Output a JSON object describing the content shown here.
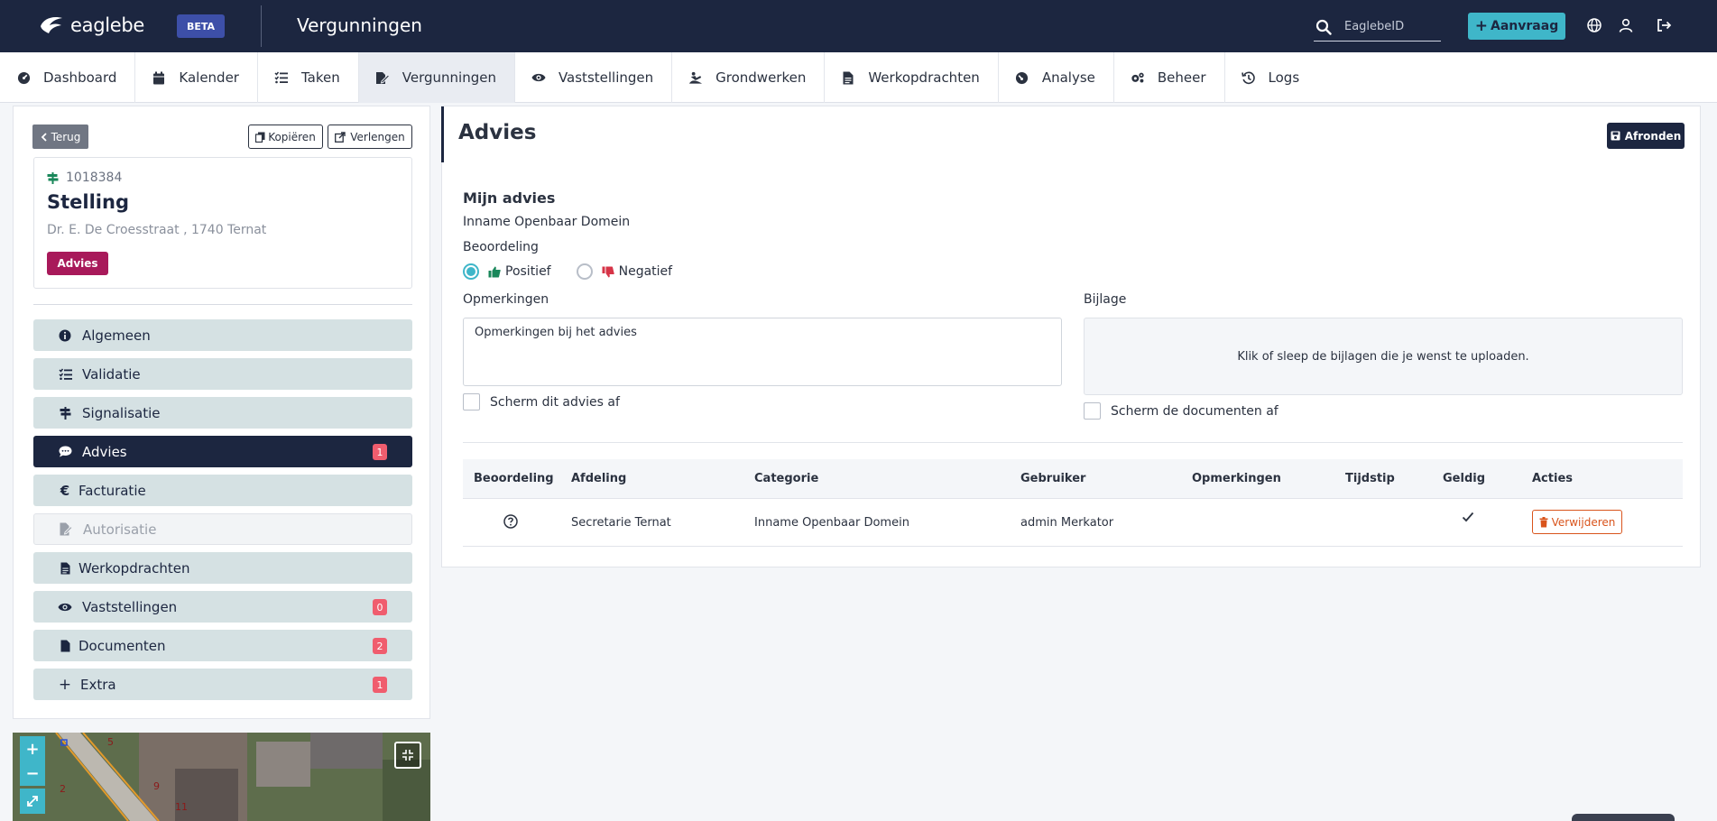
{
  "brand": {
    "logo_text": "eaglebe",
    "beta": "BETA",
    "app_title": "Vergunningen"
  },
  "header": {
    "search_placeholder": "EaglebeID",
    "aanvraag_label": "Aanvraag"
  },
  "nav": [
    {
      "label": "Dashboard",
      "icon": "dashboard-icon"
    },
    {
      "label": "Kalender",
      "icon": "calendar-icon"
    },
    {
      "label": "Taken",
      "icon": "tasks-icon"
    },
    {
      "label": "Vergunningen",
      "icon": "permit-icon",
      "active": true
    },
    {
      "label": "Vaststellingen",
      "icon": "eye-icon"
    },
    {
      "label": "Grondwerken",
      "icon": "digging-icon"
    },
    {
      "label": "Werkopdrachten",
      "icon": "document-icon"
    },
    {
      "label": "Analyse",
      "icon": "gauge-icon"
    },
    {
      "label": "Beheer",
      "icon": "gears-icon"
    },
    {
      "label": "Logs",
      "icon": "history-icon"
    }
  ],
  "left": {
    "back_label": "Terug",
    "copy_label": "Kopiëren",
    "extend_label": "Verlengen",
    "card": {
      "id": "1018384",
      "title": "Stelling",
      "address": "Dr. E. De Croesstraat , 1740 Ternat",
      "status": "Advies"
    },
    "menu": [
      {
        "label": "Algemeen",
        "icon": "info-icon"
      },
      {
        "label": "Validatie",
        "icon": "checklist-icon"
      },
      {
        "label": "Signalisatie",
        "icon": "signpost-icon"
      },
      {
        "label": "Advies",
        "icon": "comment-icon",
        "badge": "1",
        "active": true
      },
      {
        "label": "Facturatie",
        "icon": "euro-icon"
      },
      {
        "label": "Autorisatie",
        "icon": "file-signature-icon",
        "disabled": true
      },
      {
        "label": "Werkopdrachten",
        "icon": "document-icon"
      },
      {
        "label": "Vaststellingen",
        "icon": "eye-icon",
        "badge": "0"
      },
      {
        "label": "Documenten",
        "icon": "file-icon",
        "badge": "2"
      },
      {
        "label": "Extra",
        "icon": "plus-icon",
        "badge": "1"
      }
    ]
  },
  "map": {
    "zoom_in": "+",
    "zoom_out": "−"
  },
  "main": {
    "title": "Advies",
    "afronden_label": "Afronden",
    "section_title": "Mijn advies",
    "subject": "Inname Openbaar Domein",
    "beoordeling_label": "Beoordeling",
    "positive_label": "Positief",
    "negative_label": "Negatief",
    "remarks_label": "Opmerkingen",
    "remarks_value": "Opmerkingen bij het advies",
    "attachment_label": "Bijlage",
    "dropzone_text": "Klik of sleep de bijlagen die je wenst te uploaden.",
    "shield_advice_label": "Scherm dit advies af",
    "shield_docs_label": "Scherm de documenten af",
    "table": {
      "headers": [
        "Beoordeling",
        "Afdeling",
        "Categorie",
        "Gebruiker",
        "Opmerkingen",
        "Tijdstip",
        "Geldig",
        "Acties"
      ],
      "rows": [
        {
          "beoordeling_icon": "question-circle-icon",
          "afdeling": "Secretarie Ternat",
          "categorie": "Inname Openbaar Domein",
          "gebruiker": "admin Merkator",
          "opmerkingen": "",
          "tijdstip": "",
          "geldig_icon": "check-icon",
          "action_label": "Verwijderen"
        }
      ]
    }
  },
  "colors": {
    "header_bg": "#1c2640",
    "accent": "#3fb6c9",
    "status": "#a8195a",
    "badge": "#f05d6e",
    "danger": "#d9541c"
  }
}
